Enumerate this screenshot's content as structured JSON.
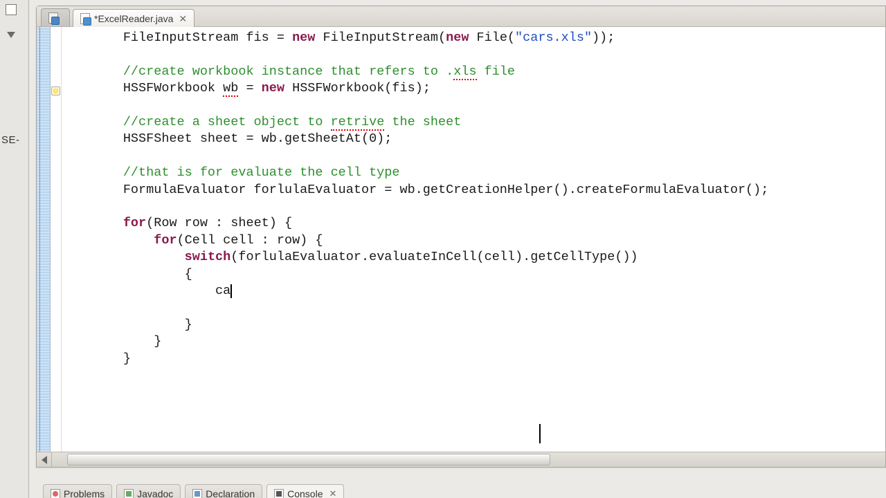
{
  "left_rail": {
    "cropped_label": "SE-"
  },
  "tabs": {
    "inactive": {
      "label": ""
    },
    "active": {
      "label": "*ExcelReader.java"
    }
  },
  "code": {
    "l01_a": "        FileInputStream fis = ",
    "l01_kw1": "new",
    "l01_b": " FileInputStream(",
    "l01_kw2": "new",
    "l01_c": " File(",
    "l01_str": "\"cars.xls\"",
    "l01_d": "));",
    "l03_cmt": "        //create workbook instance that refers to .",
    "l03_err": "xls",
    "l03_cmt2": " file",
    "l04_a": "        HSSFWorkbook ",
    "l04_err": "wb",
    "l04_b": " = ",
    "l04_kw": "new",
    "l04_c": " HSSFWorkbook(fis);",
    "l06_cmt_a": "        //create a sheet object to ",
    "l06_err": "retrive",
    "l06_cmt_b": " the sheet",
    "l07": "        HSSFSheet sheet = wb.getSheetAt(0);",
    "l09_cmt": "        //that is for evaluate the cell type",
    "l10": "        FormulaEvaluator forlulaEvaluator = wb.getCreationHelper().createFormulaEvaluator();",
    "l12_kw": "for",
    "l12_a": "(Row row : sheet) {",
    "l13_pad": "            ",
    "l13_kw": "for",
    "l13_a": "(Cell cell : row) {",
    "l14_pad": "                ",
    "l14_kw": "switch",
    "l14_a": "(forlulaEvaluator.evaluateInCell(cell).getCellType())",
    "l15": "                {",
    "l16_pad": "                    ",
    "l16_txt": "ca",
    "l17": "                    ",
    "l18": "                }",
    "l19": "            }",
    "l20": "        }"
  },
  "bottom_views": {
    "problems": "Problems",
    "javadoc": "Javadoc",
    "declaration": "Declaration",
    "console": "Console"
  }
}
